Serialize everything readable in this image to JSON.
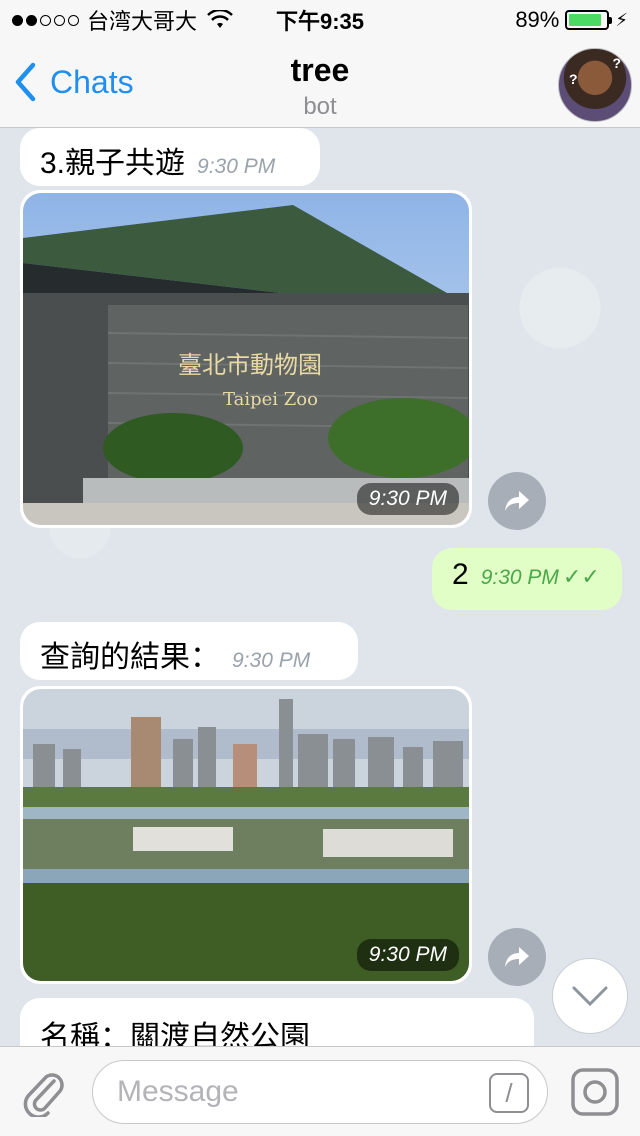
{
  "status_bar": {
    "carrier": "台湾大哥大",
    "time": "下午9:35",
    "battery_percent": "89%",
    "battery_level": 0.89
  },
  "nav": {
    "back_label": "Chats",
    "title": "tree",
    "subtitle": "bot"
  },
  "messages": [
    {
      "type": "text",
      "direction": "in",
      "text": "3.親子共遊",
      "time": "9:30 PM"
    },
    {
      "type": "photo",
      "direction": "in",
      "image": "taipei-zoo-entrance",
      "time": "9:30 PM"
    },
    {
      "type": "text",
      "direction": "out",
      "text": "2",
      "time": "9:30 PM",
      "status": "read"
    },
    {
      "type": "text",
      "direction": "in",
      "text": "查詢的結果：",
      "time": "9:30 PM"
    },
    {
      "type": "photo",
      "direction": "in",
      "image": "guandu-nature-park-skyline",
      "time": "9:30 PM"
    },
    {
      "type": "text",
      "direction": "in",
      "text": "名稱：關渡自然公園"
    }
  ],
  "input": {
    "placeholder": "Message",
    "command_symbol": "/"
  },
  "icons": {
    "back": "chevron-left-icon",
    "attach": "paperclip-icon",
    "camera": "camera-icon",
    "share": "share-icon",
    "scroll_down": "chevron-down-icon"
  },
  "colors": {
    "accent": "#1f8ff0",
    "outgoing_bubble": "#e1fec6",
    "incoming_bubble": "#ffffff",
    "battery": "#4cd964"
  }
}
